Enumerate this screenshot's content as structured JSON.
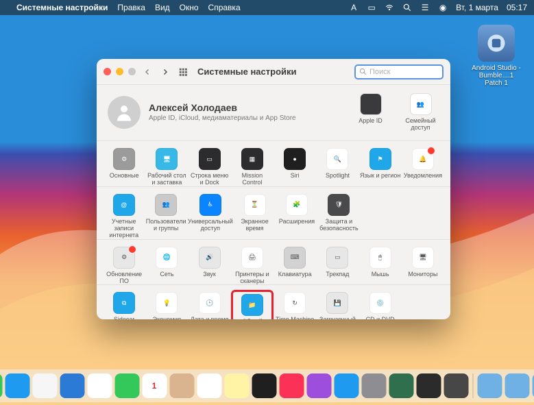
{
  "menubar": {
    "app_title": "Системные настройки",
    "items": [
      "Правка",
      "Вид",
      "Окно",
      "Справка"
    ],
    "date": "Вт, 1 марта",
    "time": "05:17"
  },
  "desktop_icon": {
    "label": "Android Studio - Bumble....1 Patch 1"
  },
  "window": {
    "title": "Системные настройки",
    "search_placeholder": "Поиск",
    "user": {
      "name": "Алексей Холодаев",
      "subtitle": "Apple ID, iCloud, медиаматериалы и App Store"
    },
    "user_right": [
      {
        "id": "apple-id",
        "label": "Apple ID",
        "bg": "#3a3a3c"
      },
      {
        "id": "family",
        "label": "Семейный доступ",
        "bg": "#ffffff"
      }
    ],
    "rows": [
      [
        {
          "id": "general",
          "label": "Основные",
          "bg": "#9b9b9b"
        },
        {
          "id": "desktop",
          "label": "Рабочий стол и заставка",
          "bg": "#38b8e6"
        },
        {
          "id": "dock",
          "label": "Строка меню и Dock",
          "bg": "#2c2c2e"
        },
        {
          "id": "mission",
          "label": "Mission Control",
          "bg": "#2c2c2e"
        },
        {
          "id": "siri",
          "label": "Siri",
          "bg": "#1f1f20"
        },
        {
          "id": "spotlight",
          "label": "Spotlight",
          "bg": "#ffffff"
        },
        {
          "id": "lang",
          "label": "Язык и регион",
          "bg": "#1fa7ea"
        },
        {
          "id": "notify",
          "label": "Уведомления",
          "bg": "#ffffff",
          "badge": true
        }
      ],
      [
        {
          "id": "internet",
          "label": "Учетные записи интернета",
          "bg": "#1fa7ea"
        },
        {
          "id": "users",
          "label": "Пользователи и группы",
          "bg": "#c9c9c9"
        },
        {
          "id": "a11y",
          "label": "Универсальный доступ",
          "bg": "#0b84ff"
        },
        {
          "id": "screentime",
          "label": "Экранное время",
          "bg": "#ffffff"
        },
        {
          "id": "ext",
          "label": "Расширения",
          "bg": "#ffffff"
        },
        {
          "id": "security",
          "label": "Защита и безопасность",
          "bg": "#4a4a4c"
        },
        {
          "id": "",
          "label": ""
        },
        {
          "id": "",
          "label": ""
        }
      ],
      [
        {
          "id": "swupdate",
          "label": "Обновление ПО",
          "bg": "#e7e7e7",
          "badge": true
        },
        {
          "id": "network",
          "label": "Сеть",
          "bg": "#ffffff"
        },
        {
          "id": "sound",
          "label": "Звук",
          "bg": "#e7e7e7"
        },
        {
          "id": "printers",
          "label": "Принтеры и сканеры",
          "bg": "#ffffff"
        },
        {
          "id": "keyboard",
          "label": "Клавиатура",
          "bg": "#d2d2d2"
        },
        {
          "id": "trackpad",
          "label": "Трекпад",
          "bg": "#e7e7e7"
        },
        {
          "id": "mouse",
          "label": "Мышь",
          "bg": "#ffffff"
        },
        {
          "id": "displays",
          "label": "Мониторы",
          "bg": "#ffffff"
        }
      ],
      [
        {
          "id": "sidecar",
          "label": "Sidecar",
          "bg": "#1fa7ea"
        },
        {
          "id": "energy",
          "label": "Экономия энергии",
          "bg": "#ffffff"
        },
        {
          "id": "datetime",
          "label": "Дата и время",
          "bg": "#ffffff"
        },
        {
          "id": "sharing",
          "label": "Общий доступ",
          "bg": "#1fa7ea",
          "highlight": true
        },
        {
          "id": "timemachine",
          "label": "Time Machine",
          "bg": "#ffffff"
        },
        {
          "id": "startup",
          "label": "Загрузочный диск",
          "bg": "#e7e7e7"
        },
        {
          "id": "cddvd",
          "label": "CD и DVD",
          "bg": "#ffffff"
        },
        {
          "id": "",
          "label": ""
        }
      ]
    ]
  },
  "dock": {
    "apps": [
      {
        "id": "finder",
        "bg": "#1eaaf1"
      },
      {
        "id": "launchpad",
        "bg": "#efefef"
      },
      {
        "id": "safari",
        "bg": "#2aa7f0"
      },
      {
        "id": "messages",
        "bg": "#34c759"
      },
      {
        "id": "mail",
        "bg": "#1e9bf0"
      },
      {
        "id": "maps",
        "bg": "#f6f6f6"
      },
      {
        "id": "vscode",
        "bg": "#2b7bd6"
      },
      {
        "id": "photos",
        "bg": "#ffffff"
      },
      {
        "id": "facetime",
        "bg": "#34c759"
      },
      {
        "id": "calendar",
        "bg": "#ffffff",
        "text": "1"
      },
      {
        "id": "contacts",
        "bg": "#d9b48f"
      },
      {
        "id": "reminders",
        "bg": "#ffffff"
      },
      {
        "id": "notes",
        "bg": "#fff3a5"
      },
      {
        "id": "appletv",
        "bg": "#1f1f20"
      },
      {
        "id": "music",
        "bg": "#fc3158"
      },
      {
        "id": "podcasts",
        "bg": "#9d4edd"
      },
      {
        "id": "appstore",
        "bg": "#1e9bf0"
      },
      {
        "id": "prefs",
        "bg": "#8d8d92"
      },
      {
        "id": "androidstudio",
        "bg": "#2f6f4d"
      },
      {
        "id": "terminal",
        "bg": "#2b2b2b"
      },
      {
        "id": "sublime",
        "bg": "#474747"
      }
    ],
    "files": [
      {
        "id": "folder1",
        "bg": "#6fb1e4"
      },
      {
        "id": "folder2",
        "bg": "#6fb1e4"
      },
      {
        "id": "folder3",
        "bg": "#6fb1e4"
      },
      {
        "id": "folder4",
        "bg": "#6fb1e4"
      },
      {
        "id": "folder5",
        "bg": "#6fb1e4"
      },
      {
        "id": "trash",
        "bg": "#d9d9d9"
      }
    ]
  },
  "icons": {
    "general": "⚙︎",
    "desktop": "🖥",
    "dock": "▭",
    "mission": "▦",
    "siri": "●",
    "spotlight": "🔍",
    "lang": "⚑",
    "notify": "🔔",
    "internet": "@",
    "users": "👥",
    "a11y": "♿︎",
    "screentime": "⏳",
    "ext": "🧩",
    "security": "🛡",
    "swupdate": "⚙︎",
    "network": "🌐",
    "sound": "🔊",
    "printers": "🖨",
    "keyboard": "⌨︎",
    "trackpad": "▭",
    "mouse": "🖱",
    "displays": "🖥",
    "sidecar": "⧉",
    "energy": "💡",
    "datetime": "🕒",
    "sharing": "📁",
    "timemachine": "↻",
    "startup": "💾",
    "cddvd": "💿",
    "apple-id": "",
    "family": "👤"
  }
}
